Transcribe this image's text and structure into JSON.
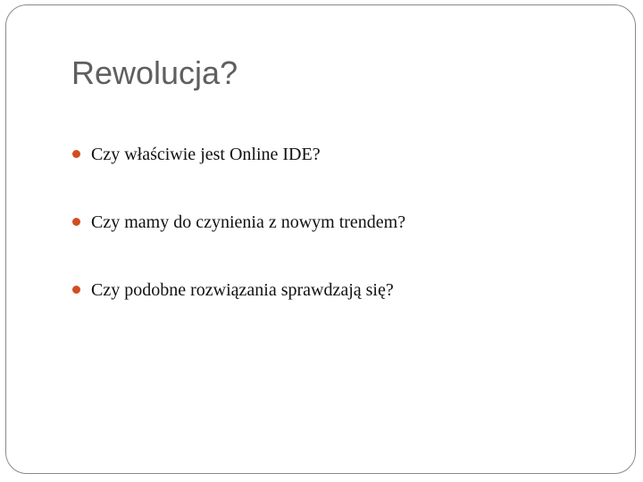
{
  "slide": {
    "title": "Rewolucja?",
    "bullet_color": "#d24d1f",
    "bullets": [
      {
        "text": "Czy właściwie jest Online IDE?"
      },
      {
        "text": "Czy mamy do czynienia z nowym trendem?"
      },
      {
        "text": "Czy podobne rozwiązania sprawdzają się?"
      }
    ]
  }
}
